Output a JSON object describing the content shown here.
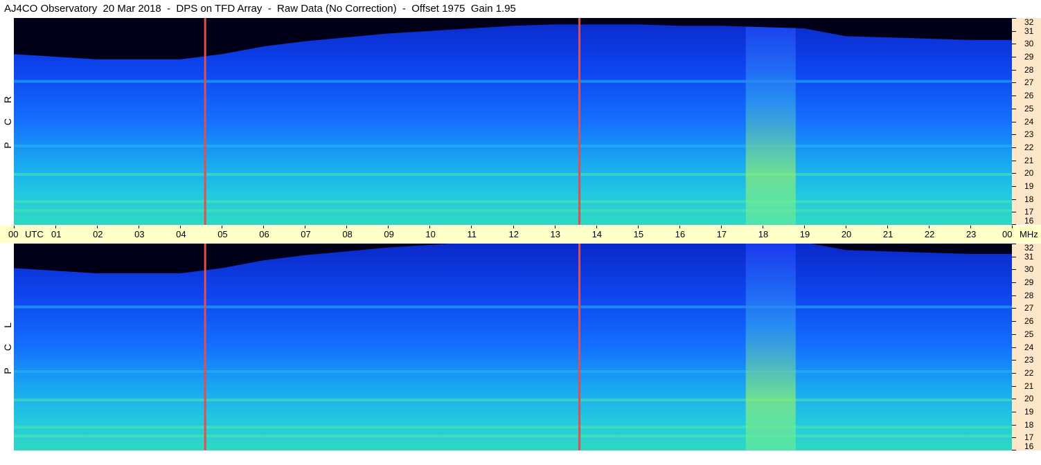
{
  "header": {
    "title": "AJ4CO Observatory  20 Mar 2018  -  DPS on TFD Array  -  Raw Data (No Correction)  -  Offset 1975  Gain 1.95"
  },
  "panels": [
    {
      "id": "rcp",
      "label": [
        "R",
        "C",
        "P"
      ]
    },
    {
      "id": "lcp",
      "label": [
        "L",
        "C",
        "P"
      ]
    }
  ],
  "time_axis": {
    "labels": [
      "00",
      "01",
      "02",
      "03",
      "04",
      "05",
      "06",
      "07",
      "08",
      "09",
      "10",
      "11",
      "12",
      "13",
      "14",
      "15",
      "16",
      "17",
      "18",
      "19",
      "20",
      "21",
      "22",
      "23",
      "00"
    ],
    "start_unit": "UTC",
    "end_unit": "MHz"
  },
  "freq_axis": {
    "labels": [
      "32",
      "31",
      "30",
      "29",
      "28",
      "27",
      "26",
      "25",
      "24",
      "23",
      "22",
      "21",
      "20",
      "19",
      "18",
      "17",
      "16"
    ]
  },
  "colors": {
    "background": "#ffffff",
    "time_axis_bg": "#ffffc8",
    "freq_axis_bg": "#fde7c8",
    "spectrogram_low": "#000010",
    "spectrogram_mid": "#1040ff",
    "spectrogram_high": "#40e0c0",
    "spectrogram_peak": "#e8ff40",
    "marker_line": "#e05050"
  },
  "chart_data": {
    "type": "heatmap",
    "title": "AJ4CO Observatory  20 Mar 2018  -  DPS on TFD Array  -  Raw Data (No Correction)  -  Offset 1975  Gain 1.95",
    "xlabel": "UTC",
    "ylabel": "MHz",
    "x_range": [
      0,
      24
    ],
    "y_range": [
      16,
      32
    ],
    "x_ticks": [
      "00",
      "01",
      "02",
      "03",
      "04",
      "05",
      "06",
      "07",
      "08",
      "09",
      "10",
      "11",
      "12",
      "13",
      "14",
      "15",
      "16",
      "17",
      "18",
      "19",
      "20",
      "21",
      "22",
      "23",
      "00"
    ],
    "y_ticks": [
      32,
      31,
      30,
      29,
      28,
      27,
      26,
      25,
      24,
      23,
      22,
      21,
      20,
      19,
      18,
      17,
      16
    ],
    "series": [
      {
        "name": "RCP",
        "panel": "top"
      },
      {
        "name": "LCP",
        "panel": "bottom"
      }
    ],
    "marker_times_utc": [
      4.6,
      13.6
    ],
    "daylight_noise_floor_mhz": [
      [
        0,
        29.2
      ],
      [
        2,
        28.8
      ],
      [
        4,
        28.8
      ],
      [
        5,
        29.2
      ],
      [
        6,
        29.8
      ],
      [
        7,
        30.2
      ],
      [
        8,
        30.5
      ],
      [
        9,
        30.8
      ],
      [
        10,
        31.0
      ],
      [
        11,
        31.2
      ],
      [
        12,
        31.4
      ],
      [
        13,
        31.5
      ],
      [
        14,
        31.5
      ],
      [
        15,
        31.5
      ],
      [
        16,
        31.4
      ],
      [
        17,
        31.4
      ],
      [
        18,
        31.3
      ],
      [
        19,
        31.2
      ],
      [
        20,
        30.6
      ],
      [
        21,
        30.5
      ],
      [
        22,
        30.4
      ],
      [
        23,
        30.3
      ],
      [
        24,
        30.3
      ]
    ],
    "bright_band_utc": [
      17.6,
      18.8
    ],
    "horizontal_bands_mhz": [
      27.1,
      22.1,
      19.9,
      17.8,
      17.1
    ]
  }
}
